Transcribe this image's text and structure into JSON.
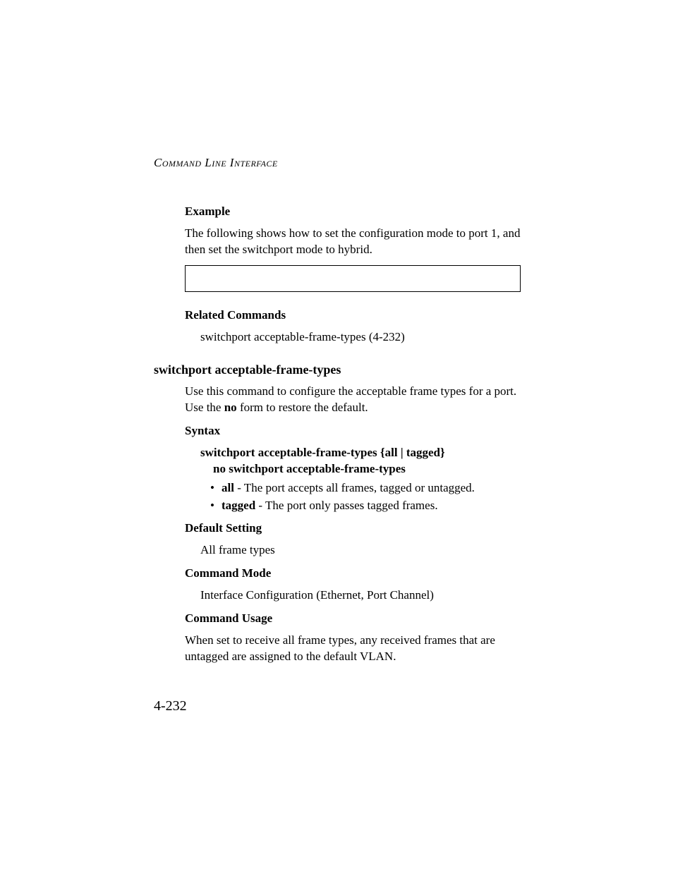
{
  "running_head": "Command Line Interface",
  "page_number": "4-232",
  "s1": {
    "h_example": "Example",
    "p_example": "The following shows how to set the configuration mode to port 1, and then set the switchport mode to hybrid.",
    "h_related": "Related Commands",
    "p_related": "switchport acceptable-frame-types (4-232)"
  },
  "s2": {
    "h_cmd": "switchport acceptable-frame-types",
    "p_intro_a": "Use this command to configure the acceptable frame types for a port. Use the ",
    "p_intro_no": "no",
    "p_intro_b": " form to restore the default.",
    "h_syntax": "Syntax",
    "syntax_line1": "switchport acceptable-frame-types {all | tagged}",
    "syntax_line2": "no switchport acceptable-frame-types",
    "bullets": [
      {
        "kw": "all",
        "desc": " - The port accepts all frames, tagged or untagged."
      },
      {
        "kw": "tagged",
        "desc": " - The port only passes tagged frames."
      }
    ],
    "h_default": "Default Setting",
    "p_default": "All frame types",
    "h_mode": "Command Mode",
    "p_mode": "Interface Configuration (Ethernet, Port Channel)",
    "h_usage": "Command Usage",
    "p_usage": "When set to receive all frame types, any received frames that are untagged are assigned to the default VLAN."
  }
}
